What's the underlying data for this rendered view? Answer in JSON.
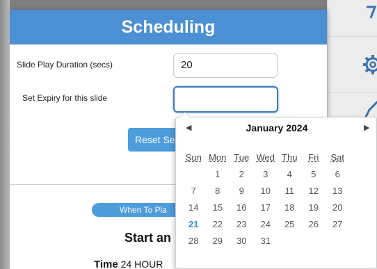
{
  "scheduling": {
    "title": "Scheduling",
    "slide_duration_label": "Slide Play Duration (secs)",
    "slide_duration_value": "20",
    "expiry_label": "Set Expiry for this slide",
    "expiry_value": "",
    "reset_button_label": "Reset Se",
    "when_to_play_label": "When To Pla",
    "start_title": "Start an",
    "time_label": "Time",
    "time_value": "24 HOUR"
  },
  "datepicker": {
    "month_year": "January 2024",
    "prev_glyph": "◀",
    "next_glyph": "▶",
    "weekdays": [
      "Sun",
      "Mon",
      "Tue",
      "Wed",
      "Thu",
      "Fri",
      "Sat"
    ],
    "weeks": [
      [
        "",
        "1",
        "2",
        "3",
        "4",
        "5",
        "6"
      ],
      [
        "7",
        "8",
        "9",
        "10",
        "11",
        "12",
        "13"
      ],
      [
        "14",
        "15",
        "16",
        "17",
        "18",
        "19",
        "20"
      ],
      [
        "21",
        "22",
        "23",
        "24",
        "25",
        "26",
        "27"
      ],
      [
        "28",
        "29",
        "30",
        "31",
        "",
        "",
        ""
      ]
    ],
    "today": "21",
    "today_color": "#2e8ee0"
  },
  "sidebar": {
    "icons": [
      "chevron-icon",
      "gear-icon",
      "edit-icon"
    ]
  },
  "colors": {
    "header_blue": "#4b8fd4",
    "button_blue": "#4d9cdb"
  }
}
